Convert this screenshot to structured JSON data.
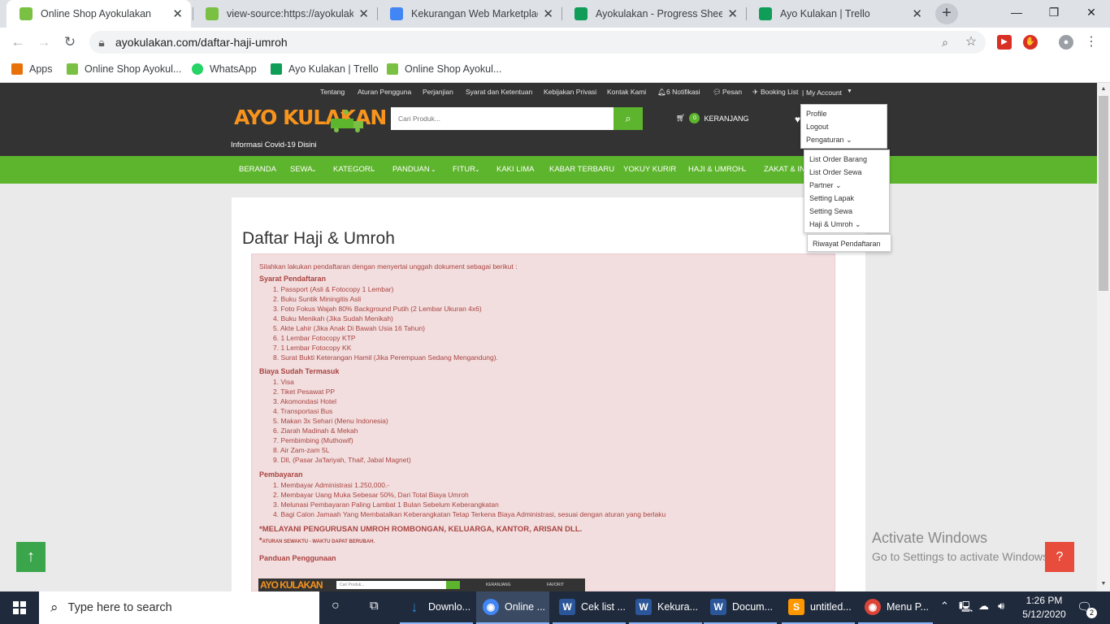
{
  "browser": {
    "tabs": [
      {
        "title": "Online Shop Ayokulakan",
        "active": true,
        "favicon_color": "#7ac143"
      },
      {
        "title": "view-source:https://ayokulakan",
        "active": false,
        "favicon_color": "#7ac143"
      },
      {
        "title": "Kekurangan Web Marketplace",
        "active": false,
        "favicon_color": "#4285f4"
      },
      {
        "title": "Ayokulakan - Progress Sheet",
        "active": false,
        "favicon_color": "#0f9d58"
      },
      {
        "title": "Ayo Kulakan | Trello",
        "active": false,
        "favicon_color": "#0f9d58"
      }
    ],
    "tab_close": "✕",
    "new_tab": "+",
    "window_controls": {
      "minimize": "—",
      "restore": "❐",
      "close": "✕"
    },
    "url": "ayokulakan.com/daftar-haji-umroh",
    "bookmarks": [
      {
        "label": "Apps",
        "color": "#e8710a"
      },
      {
        "label": "Online Shop Ayokul...",
        "color": "#7ac143"
      },
      {
        "label": "WhatsApp",
        "color": "#25d366"
      },
      {
        "label": "Ayo Kulakan | Trello",
        "color": "#0f9d58"
      },
      {
        "label": "Online Shop Ayokul...",
        "color": "#7ac143"
      }
    ]
  },
  "site": {
    "top_links": [
      "Tentang",
      "Aturan Pengguna",
      "Perjanjian",
      "Syarat dan Ketentuan",
      "Kebijakan Privasi",
      "Kontak Kami",
      "6 Notifikasi",
      "Pesan",
      "Booking List",
      "My Account"
    ],
    "logo": {
      "part1": "AYO",
      "part2": "KULAKAN"
    },
    "covid_link": "Informasi Covid-19 Disini",
    "search_placeholder": "Cari Produk...",
    "cart_count": "0",
    "cart_label": "KERANJANG",
    "nav": [
      "BERANDA",
      "SEWA",
      "KATEGORI",
      "PANDUAN",
      "FITUR",
      "KAKI LIMA",
      "KABAR TERBARU",
      "YOKUY KURIR",
      "HAJI & UMROH",
      "ZAKAT & IN"
    ],
    "account_menu": [
      "Profile",
      "Logout",
      "Pengaturan"
    ],
    "settings_menu": [
      "List Order Barang",
      "List Order Sewa",
      "Partner",
      "Setting Lapak",
      "Setting Sewa",
      "Haji & Umroh"
    ],
    "haji_menu": [
      "Riwayat Pendaftaran"
    ]
  },
  "content": {
    "title": "Daftar Haji & Umroh",
    "intro": "Silahkan lakukan pendaftaran dengan menyertai unggah dokument sebagai berikut :",
    "syarat_head": "Syarat Pendaftaran",
    "syarat": [
      "1. Passport (Asli & Fotocopy 1 Lembar)",
      "2. Buku Suntik Miningitis Asli",
      "3. Foto Fokus Wajah 80% Background Putih (2 Lembar Ukuran 4x6)",
      "4. Buku Menikah (Jika Sudah Menikah)",
      "5. Akte Lahir (Jika Anak Di Bawah Usia 16 Tahun)",
      "6. 1 Lembar Fotocopy KTP",
      "7. 1 Lembar Fotocopy KK",
      "8. Surat Bukti Keterangan Hamil (Jika Perempuan Sedang Mengandung)."
    ],
    "biaya_head": "Biaya Sudah Termasuk",
    "biaya": [
      "1. Visa",
      "2. Tiket Pesawat PP",
      "3. Akomondasi Hotel",
      "4. Transportasi Bus",
      "5. Makan 3x Sehari (Menu Indonesia)",
      "6. Ziarah Madinah & Mekah",
      "7. Pembimbing (Muthowif)",
      "8. Air Zam-zam 5L",
      "9. Dll, (Pasar Ja'fariyah, Thaif, Jabal Magnet)"
    ],
    "bayar_head": "Pembayaran",
    "bayar": [
      "1. Membayar Administrasi 1.250,000.-",
      "2. Membayar Uang Muka Sebesar 50%, Dari Total Biaya Umroh",
      "3. Melunasi Pembayaran Paling Lambat 1 Bulan Sebelum Keberangkatan",
      "4. Bagi Calon Jamaah Yang Membatalkan Keberangkatan Tetap Terkena Biaya Administrasi, sesuai dengan aturan yang berlaku"
    ],
    "notice": "*MELAYANI PENGURUSAN UMROH ROMBONGAN, KELUARGA, KANTOR, ARISAN DLL.",
    "notice_small": "ATURAN SEWAKTU - WAKTU DAPAT BERUBAH.",
    "panduan_head": "Panduan Penggunaan",
    "preview": {
      "logo": "AYO KULAKAN",
      "search": "Cari Produk...",
      "cart": "KERANJANG",
      "fav": "FAVORIT"
    }
  },
  "overlay": {
    "activate_title": "Activate Windows",
    "activate_sub": "Go to Settings to activate Windows."
  },
  "taskbar": {
    "search_placeholder": "Type here to search",
    "items": [
      {
        "label": "Downlo...",
        "color": "#2b88d8",
        "glyph": "↓"
      },
      {
        "label": "Online ...",
        "color": "#4285f4",
        "glyph": "◉"
      },
      {
        "label": "Cek list ...",
        "color": "#2b579a",
        "glyph": "W"
      },
      {
        "label": "Kekura...",
        "color": "#2b579a",
        "glyph": "W"
      },
      {
        "label": "Docum...",
        "color": "#2b579a",
        "glyph": "W"
      },
      {
        "label": "untitled...",
        "color": "#ff9800",
        "glyph": "S"
      },
      {
        "label": "Menu P...",
        "color": "#db4437",
        "glyph": "◉"
      }
    ],
    "time": "1:26 PM",
    "date": "5/12/2020",
    "notif_count": "2"
  }
}
